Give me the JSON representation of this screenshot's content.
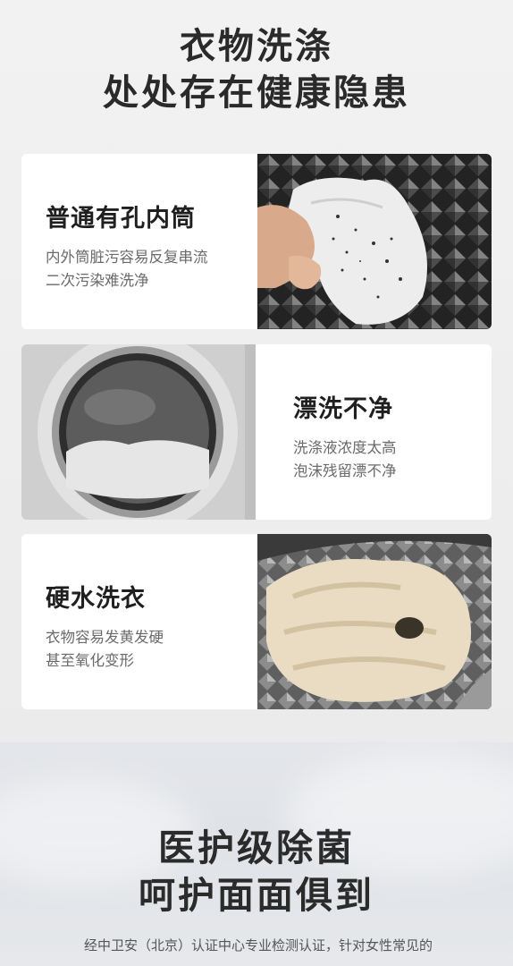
{
  "header": {
    "title_line1": "衣物洗涤",
    "title_line2": "处处存在健康隐患"
  },
  "cards": [
    {
      "heading": "普通有孔内筒",
      "lines": [
        "内外筒脏污容易反复串流",
        "二次污染难洗净"
      ],
      "photo": "dirty-tissue-on-drum-photo"
    },
    {
      "heading": "漂洗不净",
      "lines": [
        "洗涤液浓度太高",
        "泡沫残留漂不净"
      ],
      "photo": "washer-door-foam-photo"
    },
    {
      "heading": "硬水洗衣",
      "lines": [
        "衣物容易发黄发硬",
        "甚至氧化变形"
      ],
      "photo": "yellowed-towel-in-drum-photo"
    }
  ],
  "bottom": {
    "title_line1": "医护级除菌",
    "title_line2": "呵护面面俱到",
    "description": "经中卫安（北京）认证中心专业检测认证，针对女性常见的"
  }
}
